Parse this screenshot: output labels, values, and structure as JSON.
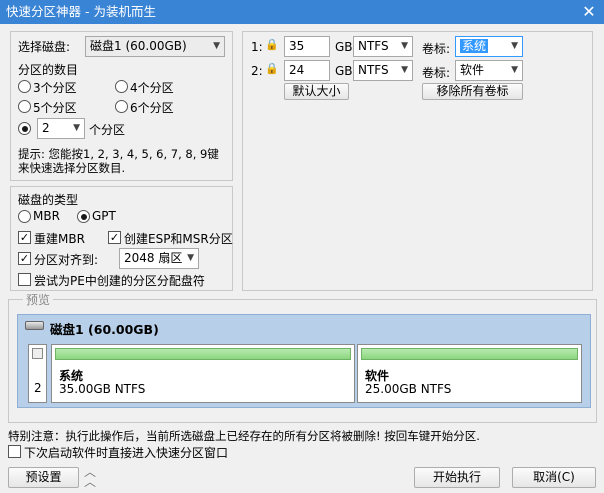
{
  "window": {
    "title": "快速分区神器 - 为装机而生",
    "close_glyph": "✕"
  },
  "disk_select": {
    "label": "选择磁盘:",
    "value": "磁盘1 (60.00GB)"
  },
  "partition_count": {
    "title": "分区的数目",
    "opt3": "3个分区",
    "opt4": "4个分区",
    "opt5": "5个分区",
    "opt6": "6个分区",
    "custom_value": "2",
    "custom_suffix": "个分区",
    "hint": "提示: 您能按1, 2, 3, 4, 5, 6, 7, 8, 9键来快速选择分区数目."
  },
  "disk_type": {
    "title": "磁盘的类型",
    "mbr": "MBR",
    "gpt": "GPT",
    "rebuild_mbr": "重建MBR",
    "create_esp": "创建ESP和MSR分区",
    "align_label": "分区对齐到:",
    "align_value": "2048 扇区",
    "assign_letters": "尝试为PE中创建的分区分配盘符"
  },
  "partitions": [
    {
      "index": "1:",
      "size": "35",
      "unit": "GB",
      "fs": "NTFS",
      "label_caption": "卷标:",
      "label": "系统"
    },
    {
      "index": "2:",
      "size": "24",
      "unit": "GB",
      "fs": "NTFS",
      "label_caption": "卷标:",
      "label": "软件"
    }
  ],
  "buttons": {
    "default_size": "默认大小",
    "remove_labels": "移除所有卷标",
    "preset": "预设置",
    "start": "开始执行",
    "cancel": "取消(C)"
  },
  "preview": {
    "title": "预览",
    "disk_name": "磁盘1 (60.00GB)",
    "disk_index": "2",
    "parts": [
      {
        "name": "系统",
        "detail": "35.00GB NTFS"
      },
      {
        "name": "软件",
        "detail": "25.00GB NTFS"
      }
    ]
  },
  "notice": "特别注意：执行此操作后，当前所选磁盘上已经存在的所有分区将被删除! 按回车键开始分区.",
  "quick_start": "下次启动软件时直接进入快速分区窗口",
  "icons": {
    "dropdown": "chevron-down-icon",
    "lock": "lock-icon",
    "disk": "disk-icon",
    "expand": "double-chevron-up-icon"
  },
  "colors": {
    "titlebar": "#3a84d6",
    "preview_panel": "#b7cfe8",
    "partition_bar": "#8bd67f",
    "selected_label": "#3399ff"
  }
}
